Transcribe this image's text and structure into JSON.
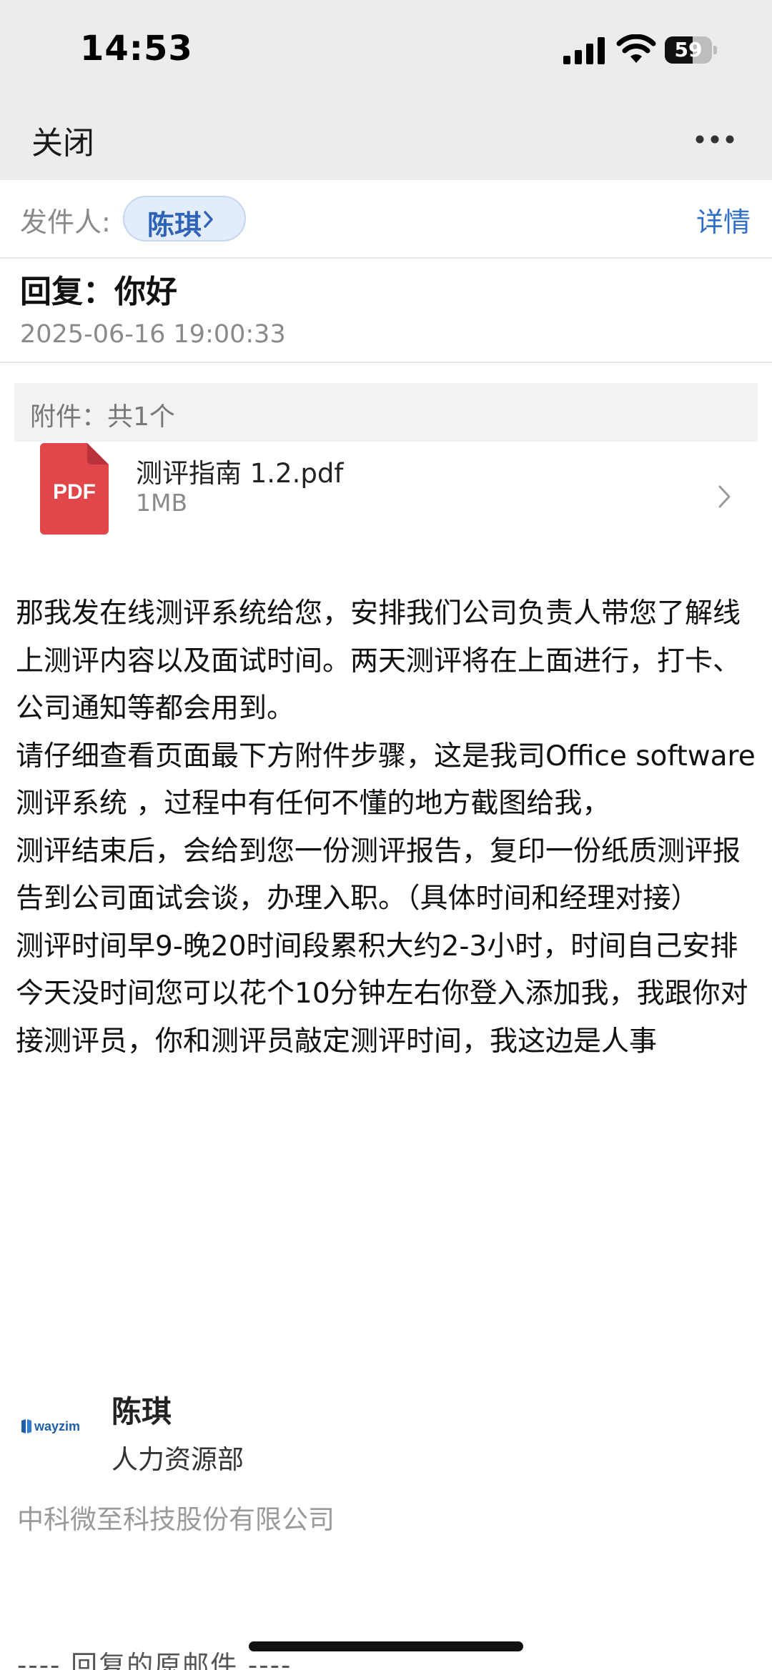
{
  "status_bar": {
    "time": "14:53",
    "battery_level": "59",
    "battery_fraction": 0.59,
    "icons": [
      "signal-icon",
      "wifi-icon",
      "battery-icon"
    ]
  },
  "nav": {
    "close_label": "关闭",
    "more_icon": "more-horizontal-icon"
  },
  "sender": {
    "label": "发件人:",
    "name": "陈琪",
    "details_label": "详情",
    "accent_color": "#2f63b8"
  },
  "email": {
    "subject": "回复：你好",
    "date": "2025-06-16 19:00:33"
  },
  "attachments": {
    "header": "附件：共1个",
    "items": [
      {
        "icon_label": "PDF",
        "name": "测评指南 1.2.pdf",
        "size": "1MB"
      }
    ],
    "pdf_color": "#e0464a"
  },
  "body": {
    "paragraphs": [
      "那我发在线测评系统给您，安排我们公司负责人带您了解线上测评内容以及面试时间。两天测评将在上面进行，打卡、公司通知等都会用到。",
      "请仔细查看页面最下方附件步骤，这是我司Office software测评系统 ，过程中有任何不懂的地方截图给我，",
      "测评结束后，会给到您一份测评报告，复印一份纸质测评报告到公司面试会谈，办理入职。（具体时间和经理对接）",
      "测评时间早9-晚20时间段累积大约2-3小时，时间自己安排",
      "今天没时间您可以花个10分钟左右你登入添加我，我跟你对接测评员，你和测评员敲定测评时间，我这边是人事"
    ]
  },
  "signature": {
    "logo_text": "wayzim",
    "name": "陈琪",
    "department": "人力资源部",
    "company": "中科微至科技股份有限公司"
  },
  "quoted": {
    "separator": "---- 回复的原邮件 ----"
  }
}
